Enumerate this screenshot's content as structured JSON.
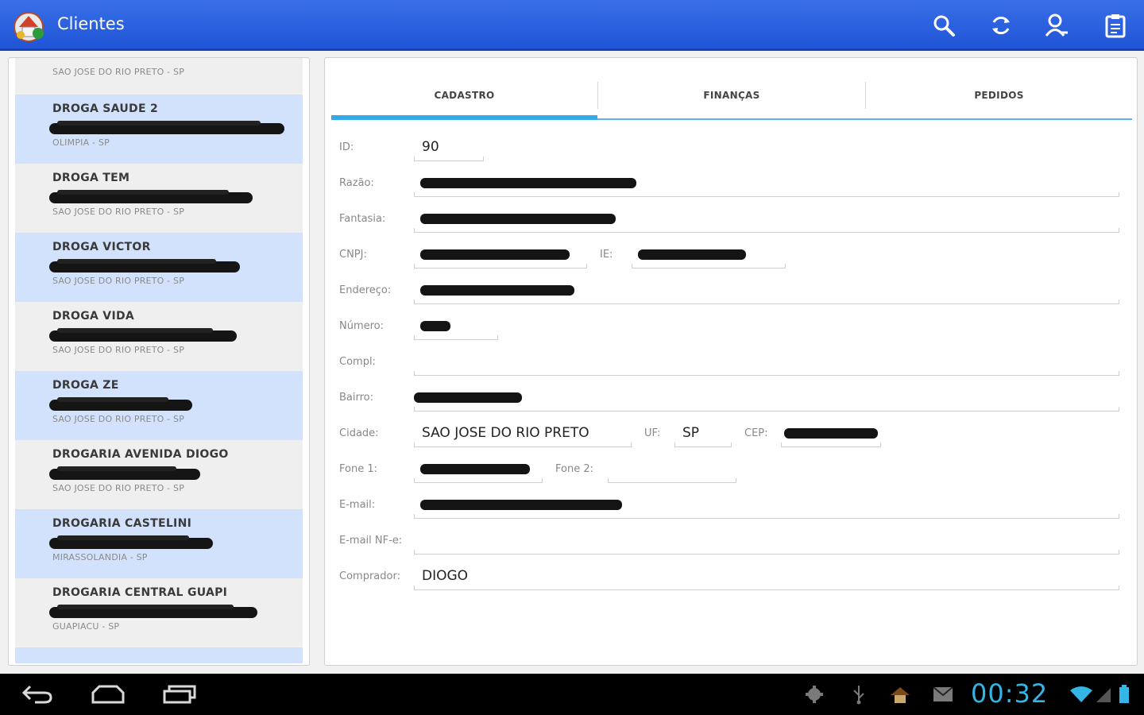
{
  "app": {
    "title": "Clientes",
    "icons": [
      "search-icon",
      "refresh-icon",
      "add-person-icon",
      "clipboard-icon"
    ],
    "accent_color": "#1f55d6"
  },
  "client_list": {
    "partial_top_city": "SAO JOSE DO RIO PRETO - SP",
    "items": [
      {
        "name": "DROGA SAUDE 2",
        "city": "OLIMPIA - SP"
      },
      {
        "name": "DROGA TEM",
        "city": "SAO JOSE DO RIO PRETO - SP"
      },
      {
        "name": "DROGA VICTOR",
        "city": "SAO JOSE DO RIO PRETO - SP"
      },
      {
        "name": "DROGA VIDA",
        "city": "SAO JOSE DO RIO PRETO - SP"
      },
      {
        "name": "DROGA ZE",
        "city": "SAO JOSE DO RIO PRETO - SP"
      },
      {
        "name": "DROGARIA AVENIDA DIOGO",
        "city": "SAO JOSE DO RIO PRETO - SP"
      },
      {
        "name": "DROGARIA CASTELINI",
        "city": "MIRASSOLANDIA - SP"
      },
      {
        "name": "DROGARIA CENTRAL GUAPI",
        "city": "GUAPIACU - SP"
      }
    ]
  },
  "tabs": [
    {
      "label": "CADASTRO",
      "active": true
    },
    {
      "label": "FINANÇAS",
      "active": false
    },
    {
      "label": "PEDIDOS",
      "active": false
    }
  ],
  "form": {
    "id_label": "ID:",
    "id_value": "90",
    "razao_label": "Razão:",
    "fantasia_label": "Fantasia:",
    "cnpj_label": "CNPJ:",
    "ie_label": "IE:",
    "endereco_label": "Endereço:",
    "numero_label": "Número:",
    "compl_label": "Compl:",
    "bairro_label": "Bairro:",
    "cidade_label": "Cidade:",
    "cidade_value": "SAO JOSE DO RIO PRETO",
    "uf_label": "UF:",
    "uf_value": "SP",
    "cep_label": "CEP:",
    "fone1_label": "Fone 1:",
    "fone2_label": "Fone 2:",
    "email_label": "E-mail:",
    "email_nfe_label": "E-mail NF-e:",
    "comprador_label": "Comprador:",
    "comprador_value": "DIOGO"
  },
  "status_bar": {
    "clock": "00:32",
    "clock_color": "#33b5e5"
  }
}
